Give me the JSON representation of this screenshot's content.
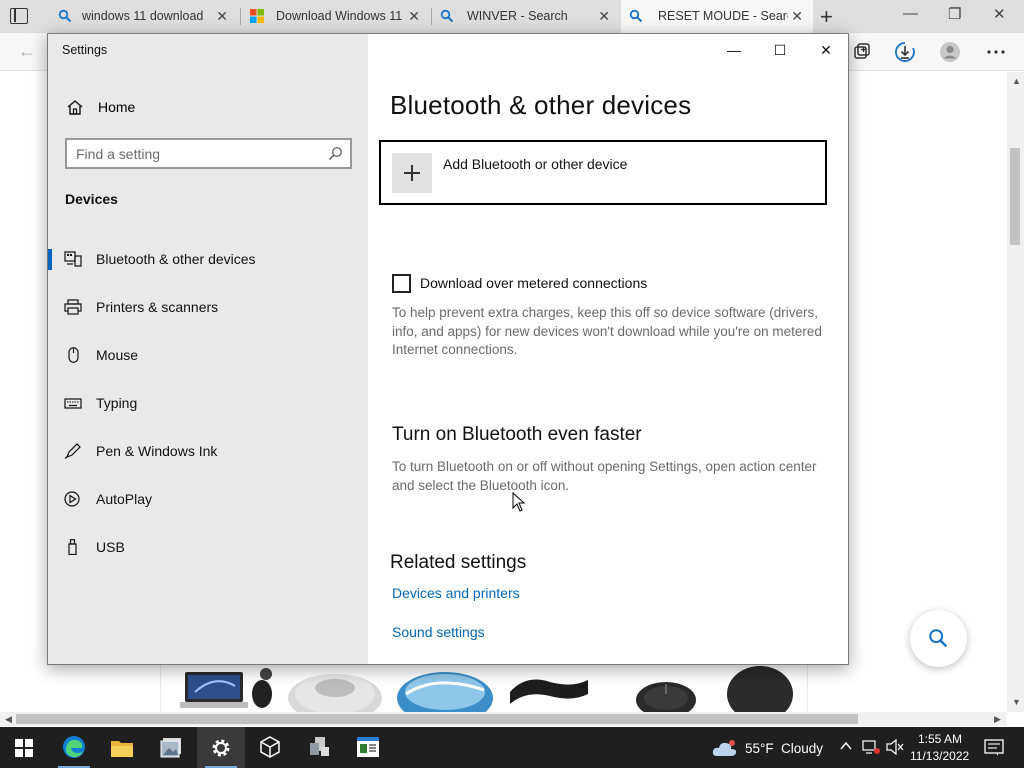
{
  "browser": {
    "tabs": [
      {
        "title": "windows 11 download",
        "icon": "search-icon",
        "active": false
      },
      {
        "title": "Download Windows 11",
        "icon": "microsoft-logo-icon",
        "active": false
      },
      {
        "title": "WINVER - Search",
        "icon": "search-icon",
        "active": false
      },
      {
        "title": "RESET MOUDE - Search",
        "icon": "search-icon",
        "active": true
      }
    ],
    "new_tab_symbol": "+",
    "close_symbol": "✕",
    "minimize_symbol": "—",
    "restore_symbol": "❐",
    "back_symbol": "←"
  },
  "settings": {
    "window_title": "Settings",
    "minimize_symbol": "—",
    "maximize_symbol": "☐",
    "close_symbol": "✕",
    "home_label": "Home",
    "search_placeholder": "Find a setting",
    "section_heading": "Devices",
    "nav": [
      {
        "label": "Bluetooth & other devices",
        "icon": "bluetooth-devices-icon",
        "selected": true
      },
      {
        "label": "Printers & scanners",
        "icon": "printer-icon",
        "selected": false
      },
      {
        "label": "Mouse",
        "icon": "mouse-icon",
        "selected": false
      },
      {
        "label": "Typing",
        "icon": "keyboard-icon",
        "selected": false
      },
      {
        "label": "Pen & Windows Ink",
        "icon": "pen-icon",
        "selected": false
      },
      {
        "label": "AutoPlay",
        "icon": "autoplay-icon",
        "selected": false
      },
      {
        "label": "USB",
        "icon": "usb-icon",
        "selected": false
      }
    ],
    "main": {
      "title": "Bluetooth & other devices",
      "add_device_label": "Add Bluetooth or other device",
      "metered_checkbox_label": "Download over metered connections",
      "metered_checked": false,
      "metered_description": "To help prevent extra charges, keep this off so device software (drivers, info, and apps) for new devices won't download while you're on metered Internet connections.",
      "faster_heading": "Turn on Bluetooth even faster",
      "faster_description": "To turn Bluetooth on or off without opening Settings, open action center and select the Bluetooth icon.",
      "related_heading": "Related settings",
      "related_links": [
        "Devices and printers",
        "Sound settings"
      ]
    }
  },
  "taskbar": {
    "apps": [
      "windows-start-icon",
      "edge-icon",
      "file-explorer-icon",
      "photos-icon",
      "settings-gear-icon",
      "3d-viewer-icon",
      "network-app-icon",
      "reader-app-icon"
    ],
    "weather_temp": "55°F",
    "weather_condition": "Cloudy",
    "time": "1:55 AM",
    "date": "11/13/2022"
  },
  "colors": {
    "accent": "#0067c0",
    "link": "#0067b8",
    "sidebar_bg": "#e9e9e9",
    "taskbar_bg": "#1f1f1f"
  }
}
